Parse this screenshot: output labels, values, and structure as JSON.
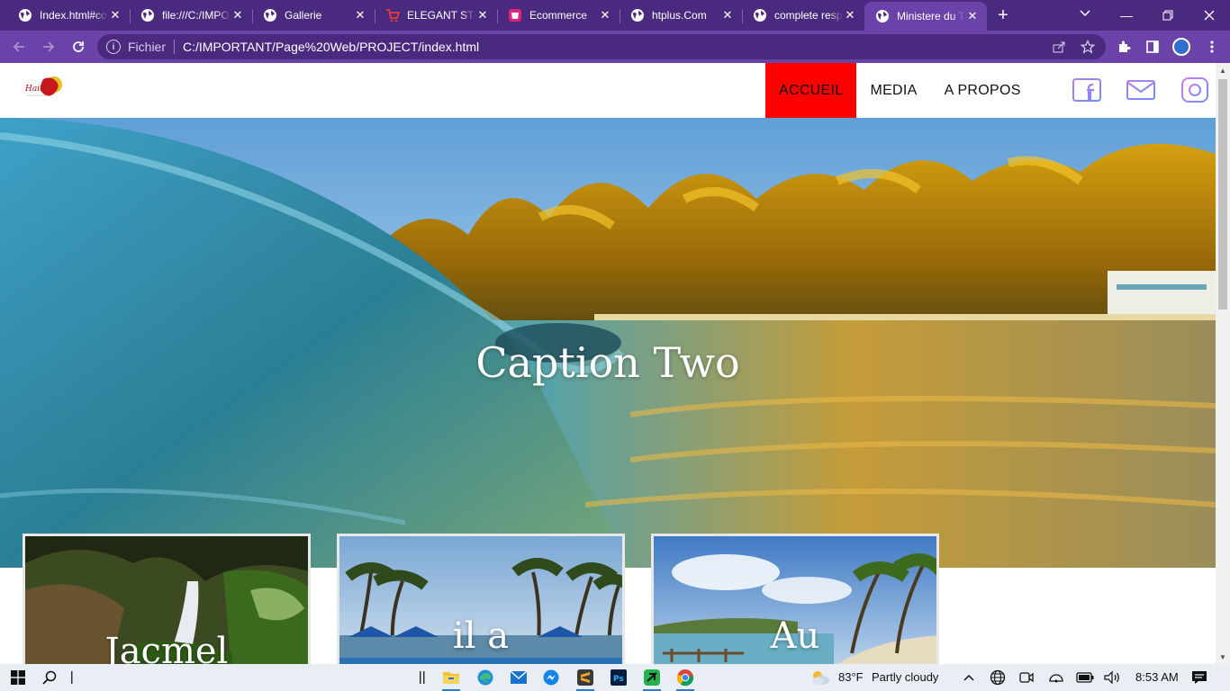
{
  "browser": {
    "tabs": [
      {
        "label": "Index.html#co",
        "icon": "globe-icon",
        "active": false
      },
      {
        "label": "file:///C:/IMPO",
        "icon": "globe-icon",
        "active": false
      },
      {
        "label": "Gallerie",
        "icon": "globe-icon",
        "active": false
      },
      {
        "label": "ELEGANT STO",
        "icon": "cart-icon",
        "active": false
      },
      {
        "label": "Ecommerce",
        "icon": "shop-icon",
        "active": false
      },
      {
        "label": "htplus.Com",
        "icon": "globe-icon",
        "active": false
      },
      {
        "label": "complete resp",
        "icon": "globe-icon",
        "active": false
      },
      {
        "label": "Ministere du T",
        "icon": "globe-icon",
        "active": true
      }
    ],
    "address": {
      "scheme_label": "Fichier",
      "url": "C:/IMPORTANT/Page%20Web/PROJECT/index.html"
    }
  },
  "site": {
    "logo_text": "Haiti",
    "menu": [
      {
        "label": "ACCUEIL",
        "active": true
      },
      {
        "label": "MEDIA",
        "active": false
      },
      {
        "label": "A PROPOS",
        "active": false
      }
    ],
    "social": [
      "facebook-icon",
      "mail-icon",
      "instagram-icon"
    ],
    "hero": {
      "caption": "Caption Two"
    },
    "cards": [
      {
        "caption": "Jacmel"
      },
      {
        "caption": "il a"
      },
      {
        "caption": "Au"
      }
    ]
  },
  "taskbar": {
    "weather": {
      "temp": "83°F",
      "condition": "Partly cloudy"
    },
    "clock": "8:53 AM"
  }
}
